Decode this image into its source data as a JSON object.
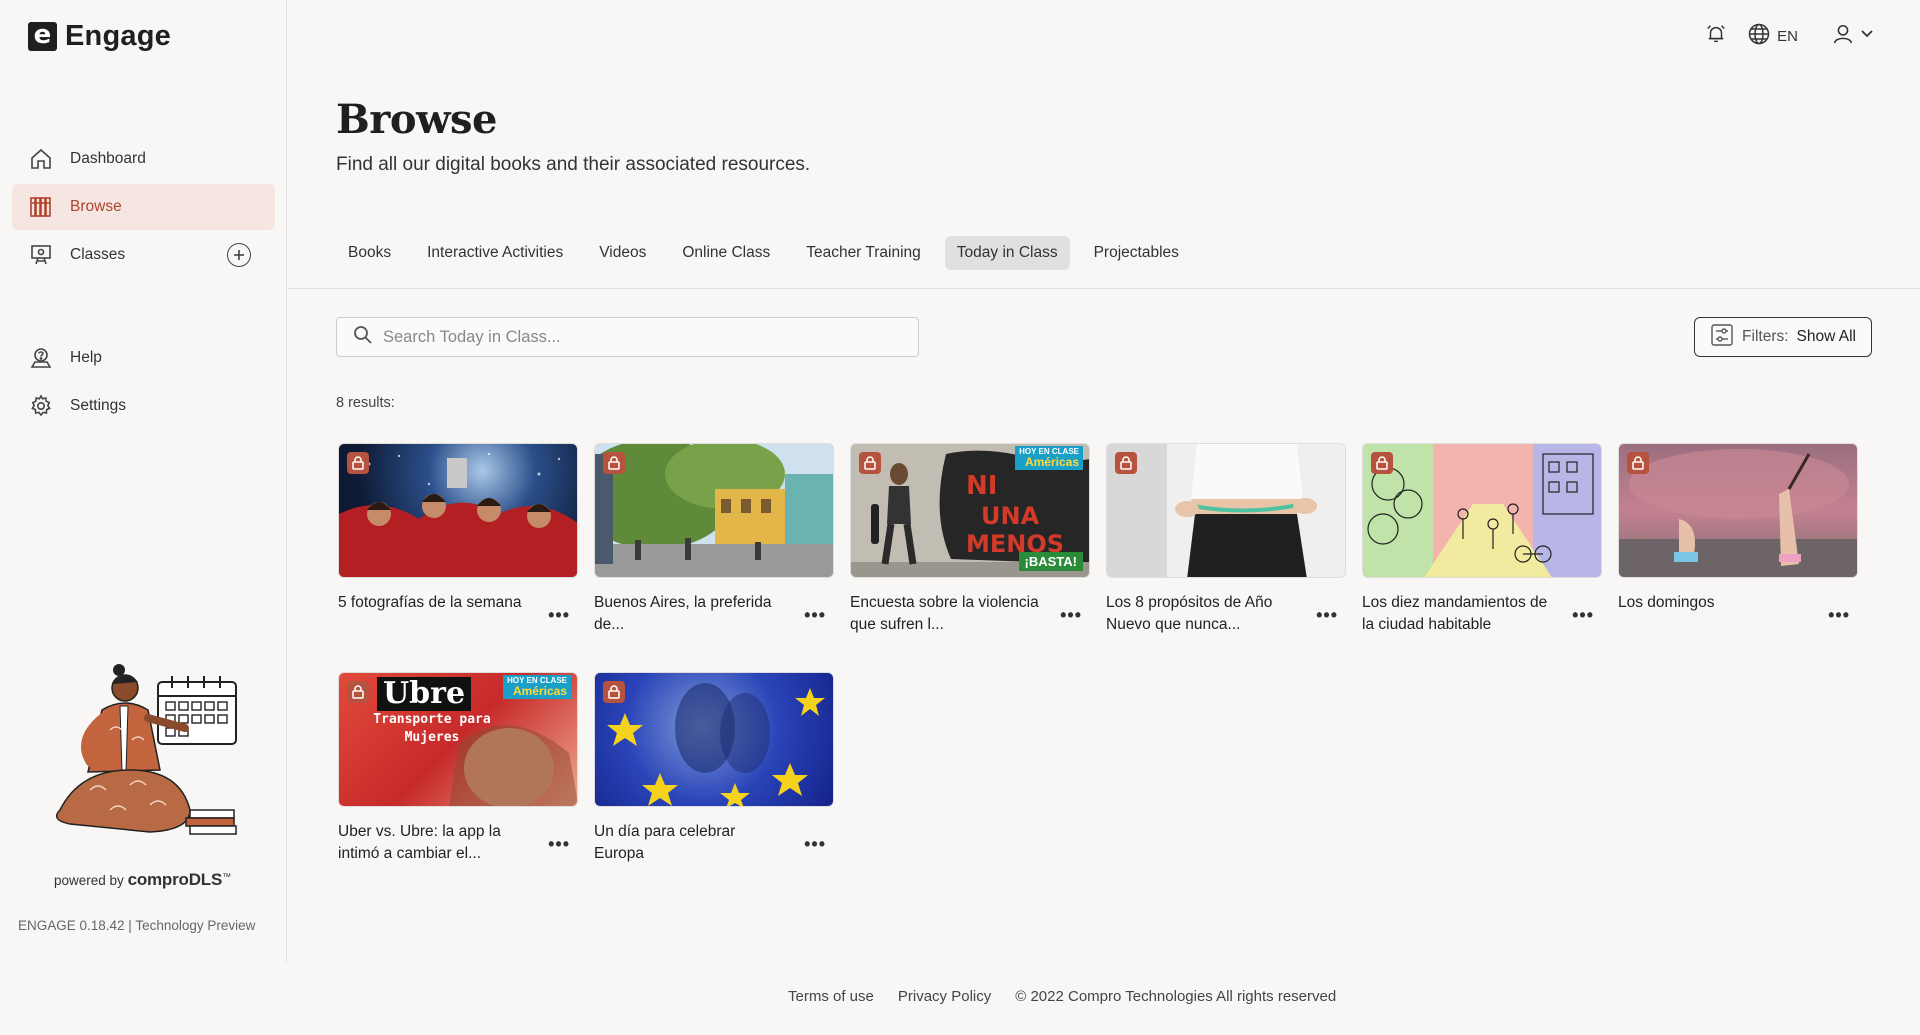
{
  "app": {
    "logo_letter": "e",
    "name": "Engage"
  },
  "sidebar": {
    "items": [
      {
        "label": "Dashboard",
        "icon": "home-icon"
      },
      {
        "label": "Browse",
        "icon": "library-icon",
        "active": true
      },
      {
        "label": "Classes",
        "icon": "classroom-icon"
      }
    ],
    "secondary": [
      {
        "label": "Help",
        "icon": "help-icon"
      },
      {
        "label": "Settings",
        "icon": "gear-icon"
      }
    ],
    "powered_prefix": "powered by",
    "powered_brand": "comproDLS",
    "powered_tm": "™",
    "version": "ENGAGE 0.18.42 | Technology Preview"
  },
  "topbar": {
    "language": "EN"
  },
  "page": {
    "title": "Browse",
    "subtitle": "Find all our digital books and their associated resources."
  },
  "tabs": [
    {
      "label": "Books"
    },
    {
      "label": "Interactive Activities"
    },
    {
      "label": "Videos"
    },
    {
      "label": "Online Class"
    },
    {
      "label": "Teacher Training"
    },
    {
      "label": "Today in Class",
      "active": true
    },
    {
      "label": "Projectables"
    }
  ],
  "search": {
    "placeholder": "Search Today in Class...",
    "value": ""
  },
  "filters": {
    "label": "Filters:",
    "value": "Show All"
  },
  "results_label": "8 results:",
  "cards": [
    {
      "title": "5 fotografías de la semana"
    },
    {
      "title": "Buenos Aires, la preferida de..."
    },
    {
      "title": "Encuesta sobre la violencia que sufren l...",
      "thumb_text_1": "HOY EN CLASE",
      "thumb_text_2": "Américas",
      "thumb_text_3": "¡BASTA!"
    },
    {
      "title": "Los 8 propósitos de Año Nuevo que nunca..."
    },
    {
      "title": "Los diez mandamientos de la ciudad habitable"
    },
    {
      "title": "Los domingos"
    },
    {
      "title": "Uber vs. Ubre: la app la intimó a cambiar el...",
      "thumb_text_1": "Ubre",
      "thumb_text_2": "Transporte para Mujeres",
      "thumb_text_3": "HOY EN CLASE",
      "thumb_text_4": "Américas"
    },
    {
      "title": "Un día para celebrar Europa"
    }
  ],
  "footer": {
    "terms": "Terms of use",
    "privacy": "Privacy Policy",
    "copyright": "© 2022 Compro Technologies All rights reserved"
  },
  "colors": {
    "accent": "#b0432c",
    "active_bg": "#f6e6e2",
    "lock": "#b5533e"
  }
}
